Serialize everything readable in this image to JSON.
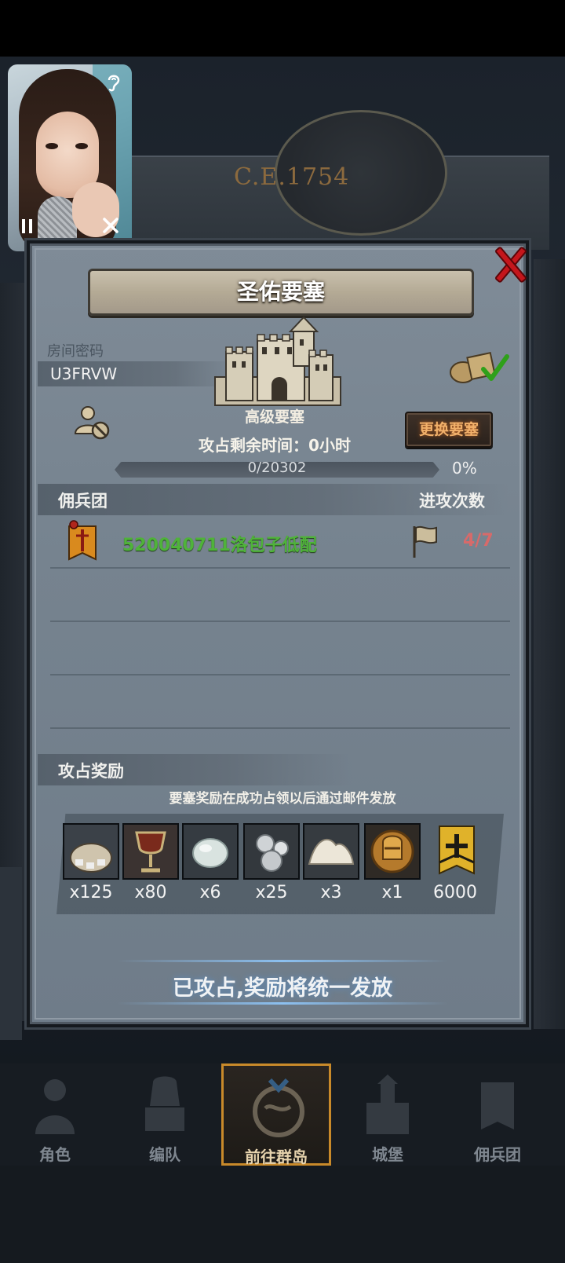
{
  "background": {
    "era_text": "C.E.1754"
  },
  "video_overlay": {
    "pause_icon": "pause-icon",
    "close_icon": "close-icon",
    "ear_icon": "ear-icon"
  },
  "dialog": {
    "title": "圣佑要塞",
    "room_label": "房间密码",
    "room_code": "U3FRVW",
    "castle_name": "高级要塞",
    "occupy_time": "攻占剩余时间：0小时",
    "change_button": "更换要塞",
    "progress": {
      "text": "0/20302",
      "percent_label": "0%",
      "value": 0
    },
    "mercenary_section": {
      "title": "佣兵团",
      "right_label": "进攻次数",
      "members": [
        {
          "name": "520040711洛包子低配",
          "attacks": "4/7"
        }
      ]
    },
    "reward_section": {
      "title": "攻占奖励",
      "note": "要塞奖励在成功占领以后通过邮件发放",
      "items": [
        {
          "icon": "supply-sack-icon",
          "qty": "x125"
        },
        {
          "icon": "goblet-icon",
          "qty": "x80"
        },
        {
          "icon": "moonstone-icon",
          "qty": "x6"
        },
        {
          "icon": "silver-ore-icon",
          "qty": "x25"
        },
        {
          "icon": "salt-pile-icon",
          "qty": "x3"
        },
        {
          "icon": "knight-medal-icon",
          "qty": "x1"
        },
        {
          "icon": "honor-banner-icon",
          "qty": "6000"
        }
      ]
    },
    "claim_status": "已攻占,奖励将统一发放"
  },
  "bottom_nav": {
    "items": [
      {
        "label": "角色",
        "icon": "character-icon"
      },
      {
        "label": "编队",
        "icon": "formation-icon"
      },
      {
        "label": "前往群岛",
        "icon": "islands-icon",
        "active": true
      },
      {
        "label": "城堡",
        "icon": "castle-icon"
      },
      {
        "label": "佣兵团",
        "icon": "mercenary-icon"
      }
    ]
  },
  "colors": {
    "member_name": "#4fb33a",
    "attack_count": "#d76a6a",
    "change_button_text": "#f1b06a",
    "close_x": "#c4161c",
    "nav_active_border": "#c98a2a"
  }
}
